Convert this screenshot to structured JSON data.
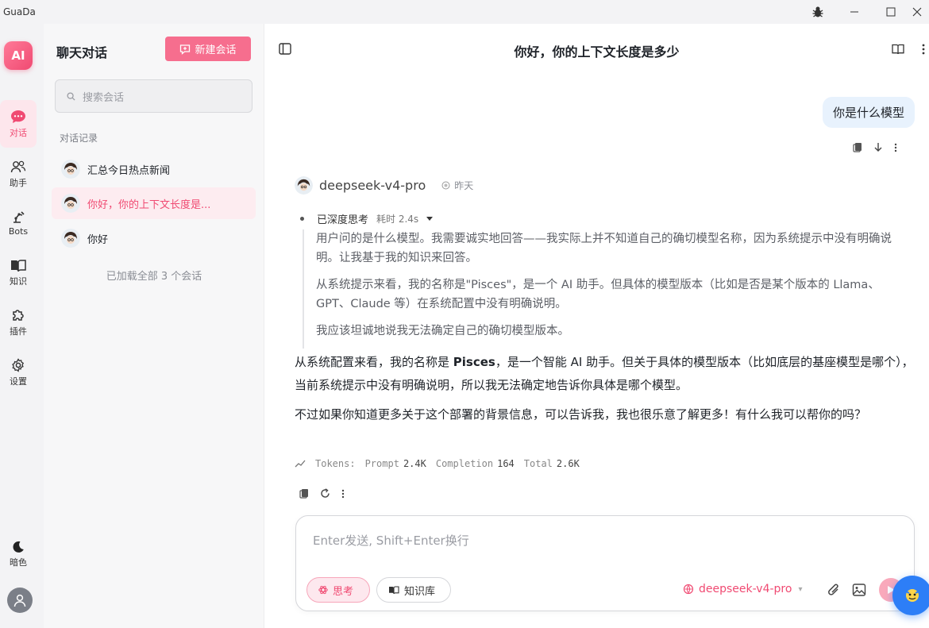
{
  "app": {
    "name": "GuaDa"
  },
  "colors": {
    "accent": "#f04a72",
    "accent_soft": "#fde6ec",
    "user_bubble": "#e8f2fd",
    "help_button": "#2d7ef7"
  },
  "rail": {
    "logo": "AI",
    "items": [
      {
        "label": "对话",
        "icon": "chat-bubble-icon",
        "active": true
      },
      {
        "label": "助手",
        "icon": "users-icon"
      },
      {
        "label": "Bots",
        "icon": "robot-arm-icon"
      },
      {
        "label": "知识",
        "icon": "book-icon"
      },
      {
        "label": "插件",
        "icon": "puzzle-icon"
      },
      {
        "label": "设置",
        "icon": "gear-icon"
      }
    ],
    "theme_label": "暗色"
  },
  "sidebar": {
    "title": "聊天对话",
    "new_button": "新建会话",
    "search_placeholder": "搜索会话",
    "section_label": "对话记录",
    "conversations": [
      {
        "title": "汇总今日热点新闻"
      },
      {
        "title": "你好，你的上下文长度是...",
        "active": true
      },
      {
        "title": "你好"
      }
    ],
    "loaded_text": "已加载全部 3 个会话"
  },
  "chat": {
    "title": "你好，你的上下文长度是多少",
    "user_message": "你是什么模型",
    "bot": {
      "model": "deepseek-v4-pro",
      "time": "昨天",
      "thinking_label": "已深度思考",
      "thinking_duration": "耗时 2.4s",
      "thinking_paragraphs": [
        "用户问的是什么模型。我需要诚实地回答——我实际上并不知道自己的确切模型名称，因为系统提示中没有明确说明。让我基于我的知识来回答。",
        "从系统提示来看，我的名称是\"Pisces\"，是一个 AI 助手。但具体的模型版本（比如是否是某个版本的 Llama、GPT、Claude 等）在系统配置中没有明确说明。",
        "我应该坦诚地说我无法确定自己的确切模型版本。"
      ],
      "answer_p1_before": "从系统配置来看，我的名称是 ",
      "answer_p1_bold": "Pisces",
      "answer_p1_after": "，是一个智能 AI 助手。但关于具体的模型版本（比如底层的基座模型是哪个），当前系统提示中没有明确说明，所以我无法确定地告诉你具体是哪个模型。",
      "answer_p2": "不过如果你知道更多关于这个部署的背景信息，可以告诉我，我也很乐意了解更多！有什么我可以帮你的吗？",
      "tokens": {
        "label": "Tokens:",
        "prompt_label": "Prompt",
        "prompt": "2.4K",
        "completion_label": "Completion",
        "completion": "164",
        "total_label": "Total",
        "total": "2.6K"
      }
    }
  },
  "composer": {
    "placeholder": "Enter发送, Shift+Enter换行",
    "think_label": "思考",
    "kb_label": "知识库",
    "model": "deepseek-v4-pro"
  }
}
